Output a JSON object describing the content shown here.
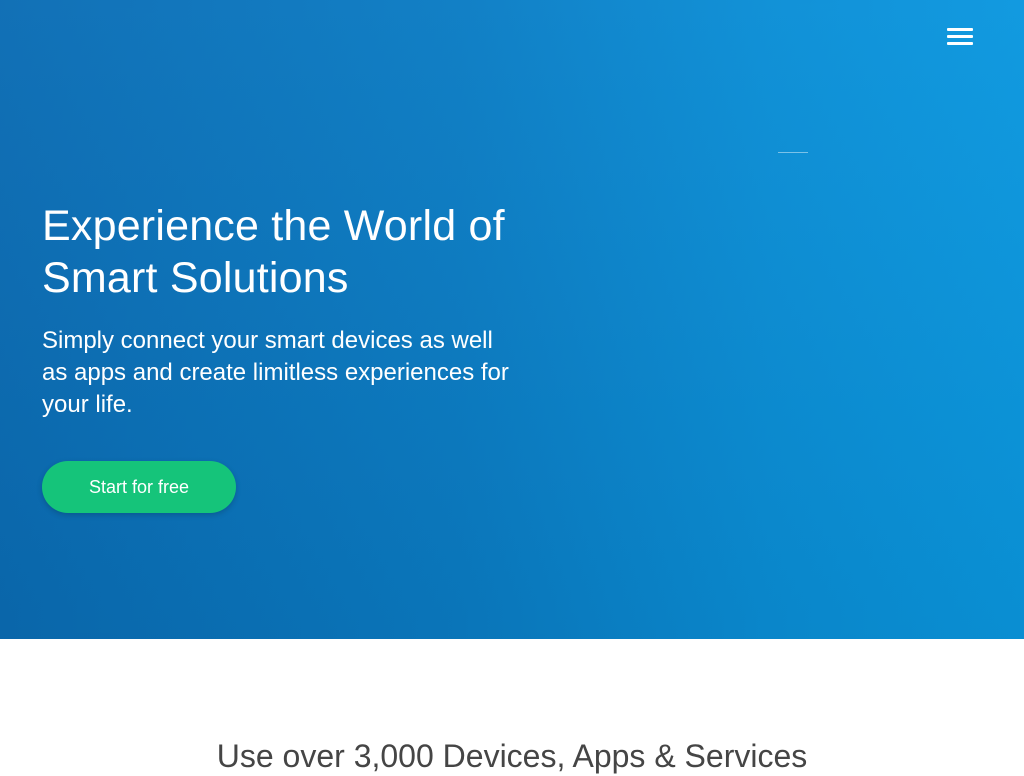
{
  "header": {
    "menu_icon": "hamburger-menu-icon"
  },
  "hero": {
    "title": "Experience the World of Smart Solutions",
    "subtitle": "Simply connect your smart devices as well as apps and create limitless experiences for your life.",
    "cta_label": "Start for free"
  },
  "features": {
    "title": "Use over 3,000 Devices, Apps & Services"
  },
  "colors": {
    "hero_blue": "#0a7cc4",
    "cta_green": "#15c47a",
    "heading_gray": "#454545"
  }
}
